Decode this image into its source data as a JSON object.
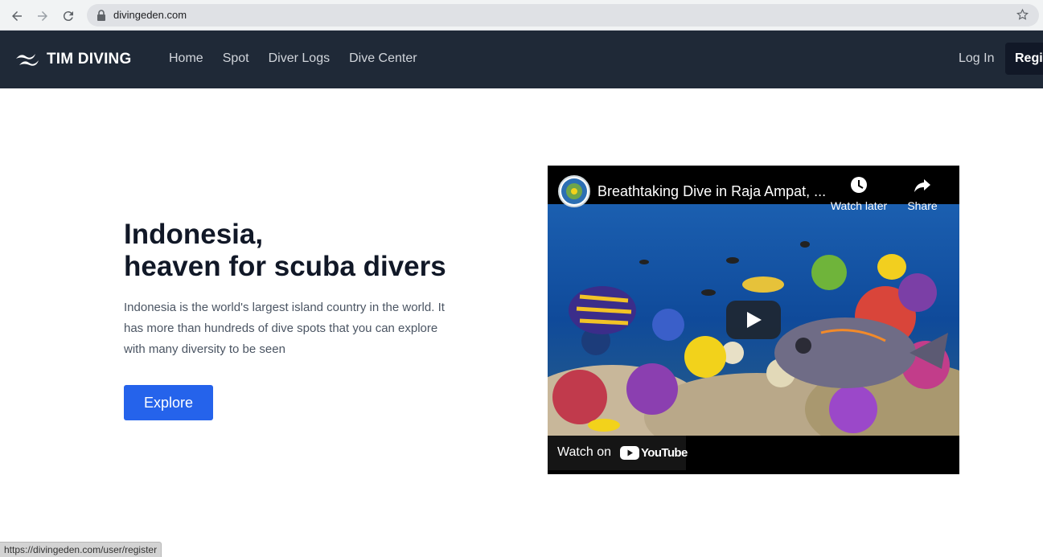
{
  "browser": {
    "url": "divingeden.com",
    "status_url": "https://divingeden.com/user/register"
  },
  "header": {
    "brand": "TIM DIVING",
    "nav": [
      {
        "label": "Home"
      },
      {
        "label": "Spot"
      },
      {
        "label": "Diver Logs"
      },
      {
        "label": "Dive Center"
      }
    ],
    "login_label": "Log In",
    "register_label": "Regis"
  },
  "hero": {
    "title_line1": "Indonesia,",
    "title_line2": "heaven for scuba divers",
    "description": "Indonesia is the world's largest island country in the world. It has more than hundreds of dive spots that you can explore with many diversity to be seen",
    "cta_label": "Explore"
  },
  "video": {
    "title": "Breathtaking Dive in Raja Ampat, ...",
    "watch_later_label": "Watch later",
    "share_label": "Share",
    "watch_on_label": "Watch on",
    "youtube_label": "YouTube"
  },
  "colors": {
    "header_bg": "#1f2937",
    "cta_bg": "#2563eb",
    "title_text": "#111827"
  },
  "icons": [
    "back-arrow-icon",
    "forward-arrow-icon",
    "reload-icon",
    "lock-icon",
    "star-icon",
    "wave-logo-icon",
    "clock-icon",
    "share-arrow-icon",
    "play-icon",
    "youtube-logo-icon"
  ]
}
